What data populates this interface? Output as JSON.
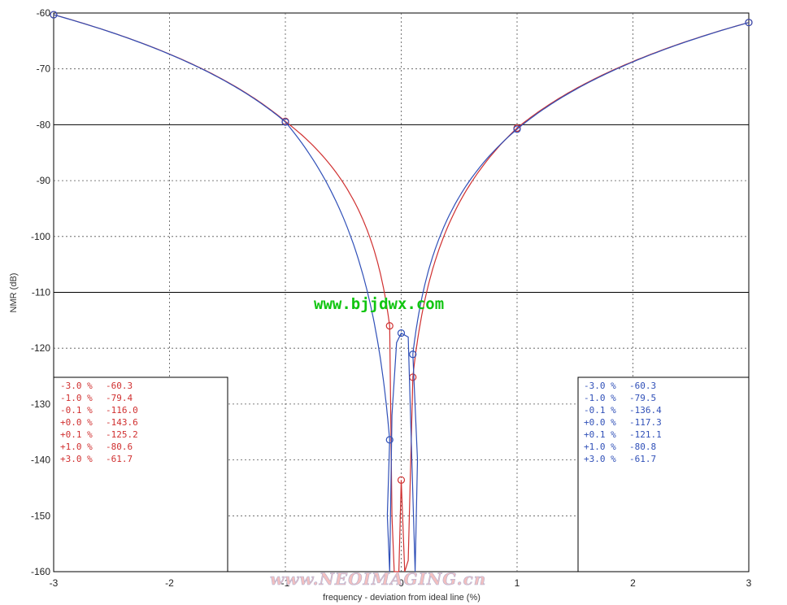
{
  "chart_data": {
    "type": "line",
    "xlabel": "frequency - deviation from ideal line (%)",
    "ylabel": "NMR (dB)",
    "xlim": [
      -3,
      3
    ],
    "ylim": [
      -160,
      -60
    ],
    "x_ticks": [
      "-3",
      "-2",
      "-1",
      "0",
      "1",
      "2",
      "3"
    ],
    "y_ticks": [
      "-60",
      "-70",
      "-80",
      "-90",
      "-100",
      "-110",
      "-120",
      "-130",
      "-140",
      "-150",
      "-160"
    ],
    "grid": "dotted",
    "solid_gridlines_y": [
      -80,
      -110
    ],
    "series": [
      {
        "color": "#d03030",
        "points": [
          {
            "x": -3.0,
            "y": -60.3
          },
          {
            "x": -1.0,
            "y": -79.4
          },
          {
            "x": -0.1,
            "y": -116.0
          },
          {
            "x": 0.0,
            "y": -143.6
          },
          {
            "x": 0.1,
            "y": -125.2
          },
          {
            "x": 1.0,
            "y": -80.6
          },
          {
            "x": 3.0,
            "y": -61.7
          }
        ]
      },
      {
        "color": "#3050b8",
        "points": [
          {
            "x": -3.0,
            "y": -60.3
          },
          {
            "x": -1.0,
            "y": -79.5
          },
          {
            "x": -0.1,
            "y": -136.4
          },
          {
            "x": 0.0,
            "y": -117.3
          },
          {
            "x": 0.1,
            "y": -121.1
          },
          {
            "x": 1.0,
            "y": -80.8
          },
          {
            "x": 3.0,
            "y": -61.7
          }
        ]
      }
    ],
    "legend_left": {
      "color": "#d03030",
      "rows": [
        [
          "-3.0 %",
          "-60.3"
        ],
        [
          "-1.0 %",
          "-79.4"
        ],
        [
          "-0.1 %",
          "-116.0"
        ],
        [
          "+0.0 %",
          "-143.6"
        ],
        [
          "+0.1 %",
          "-125.2"
        ],
        [
          "+1.0 %",
          "-80.6"
        ],
        [
          "+3.0 %",
          "-61.7"
        ]
      ]
    },
    "legend_right": {
      "color": "#3050b8",
      "rows": [
        [
          "-3.0 %",
          "-60.3"
        ],
        [
          "-1.0 %",
          "-79.5"
        ],
        [
          "-0.1 %",
          "-136.4"
        ],
        [
          "+0.0 %",
          "-117.3"
        ],
        [
          "+0.1 %",
          "-121.1"
        ],
        [
          "+1.0 %",
          "-80.8"
        ],
        [
          "+3.0 %",
          "-61.7"
        ]
      ]
    }
  },
  "watermarks": {
    "top": "www.bjjdwx.com",
    "bottom": "www.NEOIMAGING.cn"
  }
}
